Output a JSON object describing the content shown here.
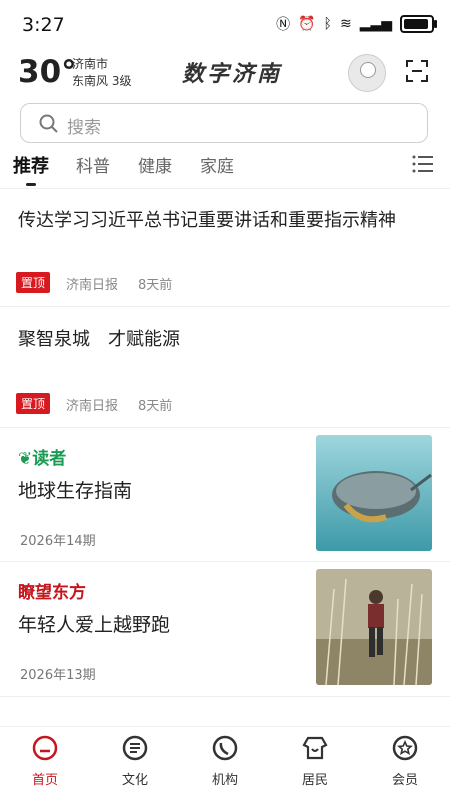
{
  "status": {
    "time": "3:27"
  },
  "header": {
    "temperature": "30°",
    "city": "济南市",
    "wind": "东南风  3级",
    "brand": "数字济南"
  },
  "search": {
    "placeholder": "搜索"
  },
  "tabs": [
    {
      "label": "推荐",
      "active": true
    },
    {
      "label": "科普"
    },
    {
      "label": "健康"
    },
    {
      "label": "家庭"
    }
  ],
  "news": [
    {
      "title": "传达学习习近平总书记重要讲话和重要指示精神",
      "badge": "置顶",
      "source": "济南日报",
      "time": "8天前"
    },
    {
      "title": "聚智泉城　才赋能源",
      "badge": "置顶",
      "source": "济南日报",
      "time": "8天前"
    }
  ],
  "magazines": [
    {
      "logo": "读者",
      "title": "地球生存指南",
      "issue": "2026年14期"
    },
    {
      "logo": "瞭望东方",
      "title": "年轻人爱上越野跑",
      "issue": "2026年13期"
    }
  ],
  "bottom_nav": [
    {
      "label": "首页",
      "active": true
    },
    {
      "label": "文化"
    },
    {
      "label": "机构"
    },
    {
      "label": "居民"
    },
    {
      "label": "会员"
    }
  ],
  "colors": {
    "accent": "#c4161c",
    "badge": "#d71920",
    "duzhe_green": "#1a9b52"
  }
}
